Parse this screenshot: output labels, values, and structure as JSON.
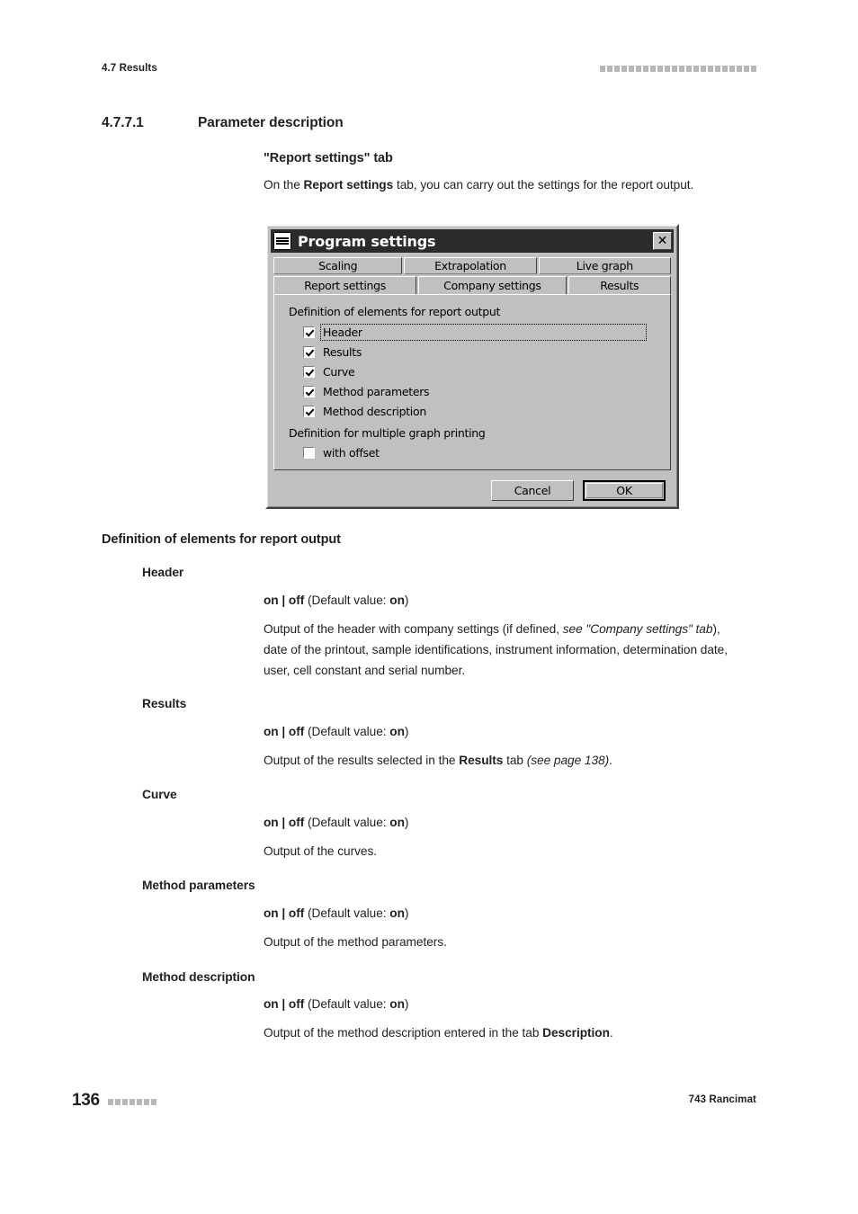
{
  "page": {
    "running_header": "4.7 Results",
    "header_square_count": 22,
    "footer_square_count": 7,
    "page_number": "136",
    "footer_right": "743 Rancimat"
  },
  "section": {
    "number": "4.7.7.1",
    "title": "Parameter description"
  },
  "intro": {
    "heading": "\"Report settings\" tab",
    "body_before": "On the ",
    "body_bold": "Report settings",
    "body_after": " tab, you can carry out the settings for the report output."
  },
  "dialog": {
    "title": "Program settings",
    "close_label": "✕",
    "tabs_row1": [
      {
        "label": "Scaling",
        "active": false
      },
      {
        "label": "Extrapolation",
        "active": false
      },
      {
        "label": "Live graph",
        "active": false
      }
    ],
    "tabs_row2": [
      {
        "label": "Report settings",
        "active": true
      },
      {
        "label": "Company settings",
        "active": false
      },
      {
        "label": "Results",
        "active": false
      }
    ],
    "group1_label": "Definition of elements for report output",
    "checkboxes": [
      {
        "label": "Header",
        "checked": true,
        "focused": true
      },
      {
        "label": "Results",
        "checked": true,
        "focused": false
      },
      {
        "label": "Curve",
        "checked": true,
        "focused": false
      },
      {
        "label": "Method parameters",
        "checked": true,
        "focused": false
      },
      {
        "label": "Method description",
        "checked": true,
        "focused": false
      }
    ],
    "group2_label": "Definition for multiple graph printing",
    "offset_checkbox": {
      "label": "with offset",
      "checked": false
    },
    "cancel_label": "Cancel",
    "ok_label": "OK"
  },
  "body_heading": "Definition of elements for report output",
  "entries": [
    {
      "term": "Header",
      "value_bold_a": "on",
      "value_sep": " | ",
      "value_bold_b": "off",
      "value_default_prefix": " (Default value: ",
      "value_default_bold": "on",
      "value_default_suffix": ")",
      "desc_1": "Output of the header with company settings (if defined, ",
      "desc_italic": "see \"Company settings\" tab",
      "desc_2": "), date of the printout, sample identifications, instrument information, determination date, user, cell constant and serial number."
    },
    {
      "term": "Results",
      "desc_1": "Output of the results selected in the ",
      "desc_bold": "Results",
      "desc_2": " tab ",
      "desc_italic": "(see page 138)",
      "desc_3": "."
    },
    {
      "term": "Curve",
      "desc_1": "Output of the curves."
    },
    {
      "term": "Method parameters",
      "desc_1": "Output of the method parameters."
    },
    {
      "term": "Method description",
      "desc_1": "Output of the method description entered in the tab ",
      "desc_bold": "Description",
      "desc_2": "."
    }
  ],
  "shared": {
    "on": "on",
    "off": "off",
    "sep": " | ",
    "default_prefix": " (Default value: ",
    "default_suffix": ")"
  }
}
